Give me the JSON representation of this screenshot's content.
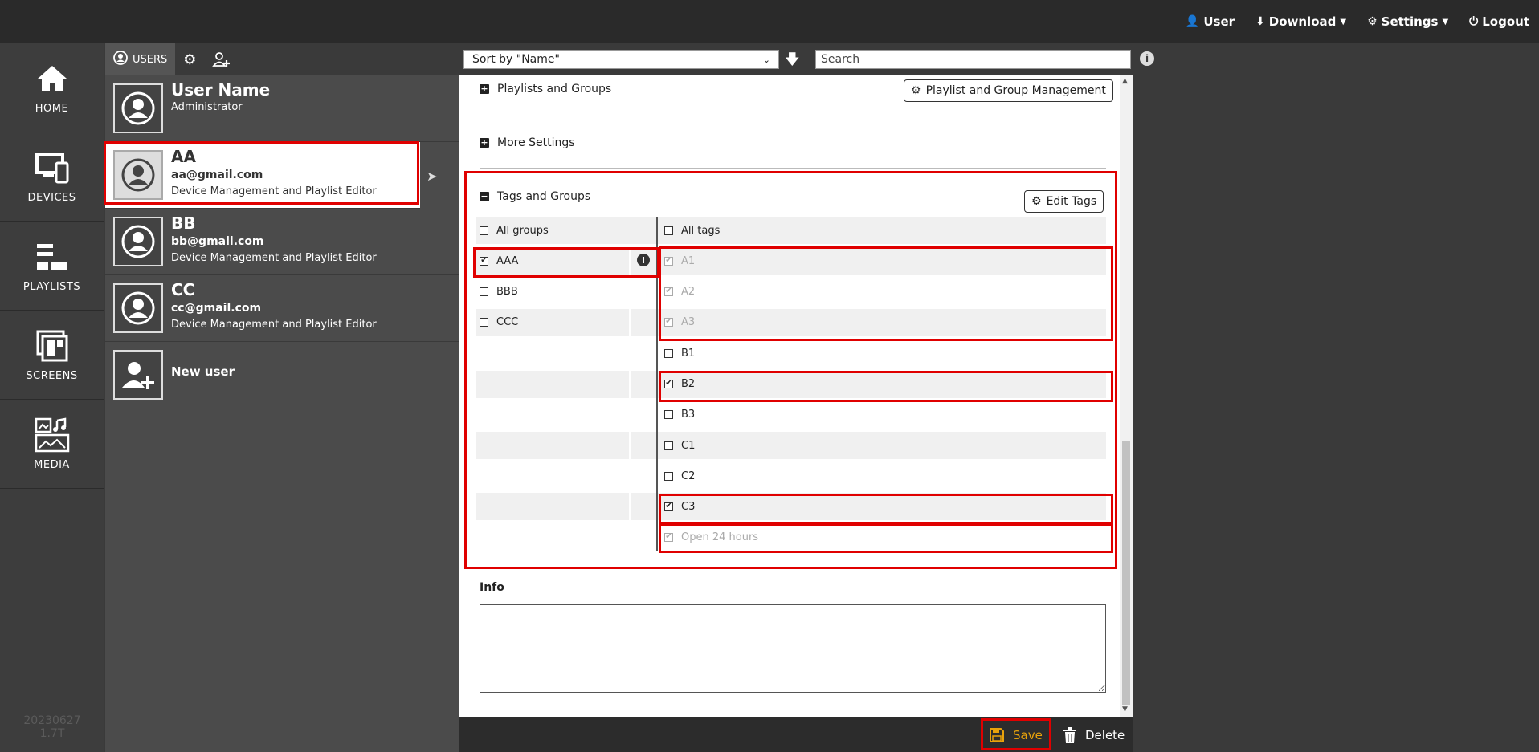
{
  "topnav": {
    "user": "User",
    "download": "Download",
    "settings": "Settings",
    "logout": "Logout"
  },
  "leftnav": {
    "items": [
      {
        "label": "HOME",
        "icon": "home-icon"
      },
      {
        "label": "DEVICES",
        "icon": "devices-icon"
      },
      {
        "label": "PLAYLISTS",
        "icon": "playlists-icon"
      },
      {
        "label": "SCREENS",
        "icon": "screens-icon"
      },
      {
        "label": "MEDIA",
        "icon": "media-icon"
      }
    ],
    "version_date": "20230627",
    "version_num": "1.7T"
  },
  "userpanel": {
    "tab_users": "USERS",
    "users": [
      {
        "name": "User Name",
        "email": "",
        "role": "Administrator"
      },
      {
        "name": "AA",
        "email": "aa@gmail.com",
        "role": "Device Management and Playlist Editor"
      },
      {
        "name": "BB",
        "email": "bb@gmail.com",
        "role": "Device Management and Playlist Editor"
      },
      {
        "name": "CC",
        "email": "cc@gmail.com",
        "role": "Device Management and Playlist Editor"
      }
    ],
    "new_user": "New user"
  },
  "toolbar": {
    "sort_value": "Sort by \"Name\"",
    "search_placeholder": "Search"
  },
  "detail": {
    "playlists_groups": "Playlists and Groups",
    "playlist_group_mgmt": "Playlist and Group Management",
    "more_settings": "More Settings",
    "tags_groups": "Tags and Groups",
    "edit_tags": "Edit Tags",
    "all_groups": "All groups",
    "all_tags": "All tags",
    "groups": [
      {
        "label": "AAA",
        "checked": true
      },
      {
        "label": "BBB",
        "checked": false
      },
      {
        "label": "CCC",
        "checked": false
      }
    ],
    "tags": [
      {
        "label": "A1",
        "checked": true,
        "dim": true
      },
      {
        "label": "A2",
        "checked": true,
        "dim": true
      },
      {
        "label": "A3",
        "checked": true,
        "dim": true
      },
      {
        "label": "B1",
        "checked": false,
        "dim": false
      },
      {
        "label": "B2",
        "checked": true,
        "dim": false
      },
      {
        "label": "B3",
        "checked": false,
        "dim": false
      },
      {
        "label": "C1",
        "checked": false,
        "dim": false
      },
      {
        "label": "C2",
        "checked": false,
        "dim": false
      },
      {
        "label": "C3",
        "checked": true,
        "dim": false
      },
      {
        "label": "Open 24 hours",
        "checked": true,
        "dim": true
      }
    ],
    "info_label": "Info"
  },
  "bottombar": {
    "save": "Save",
    "delete": "Delete"
  },
  "colors": {
    "accent_red": "#e00000",
    "save_orange": "#e8a20b",
    "topbar": "#2a2a2a"
  }
}
